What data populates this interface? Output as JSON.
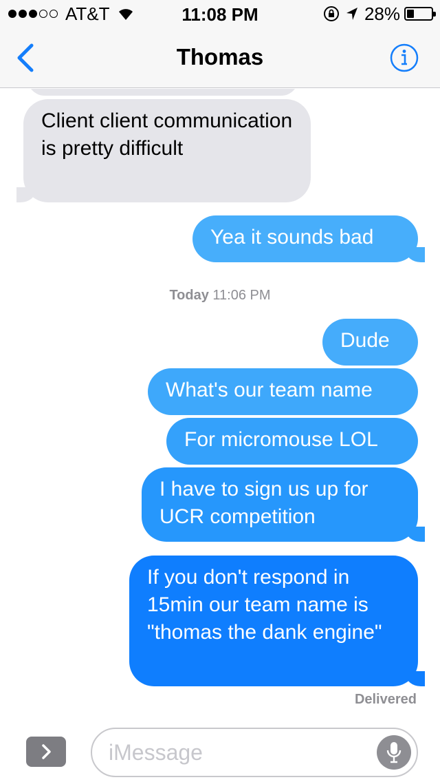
{
  "status_bar": {
    "carrier": "AT&T",
    "time": "11:08 PM",
    "battery": "28%",
    "battery_level": 0.28,
    "signal_bars": 3
  },
  "nav": {
    "title": "Thomas",
    "back_icon": "chevron-left-icon",
    "info_icon": "info-icon"
  },
  "colors": {
    "accent": "#147efb",
    "received_bubble": "#e5e5ea",
    "sent_bubble_top": "#4fb1fb",
    "sent_bubble_bottom": "#0a78fe",
    "meta_text": "#8e8e93"
  },
  "thread": {
    "messages": [
      {
        "direction": "received",
        "text": "Client client communication is pretty difficult"
      },
      {
        "direction": "sent",
        "text": "Yea it sounds bad"
      },
      {
        "direction": "sent",
        "text": "Dude"
      },
      {
        "direction": "sent",
        "text": "What's our team name"
      },
      {
        "direction": "sent",
        "text": "For micromouse LOL"
      },
      {
        "direction": "sent",
        "text": "I have to sign us up for UCR competition"
      },
      {
        "direction": "sent",
        "text": "If you don't respond in 15min our team name is \"thomas the dank engine\""
      }
    ],
    "timestamp": {
      "day": "Today",
      "time": "11:06 PM"
    },
    "delivered": "Delivered"
  },
  "input": {
    "placeholder": "iMessage",
    "value": "",
    "apps_icon": "chevron-right-icon",
    "mic_icon": "microphone-icon"
  }
}
